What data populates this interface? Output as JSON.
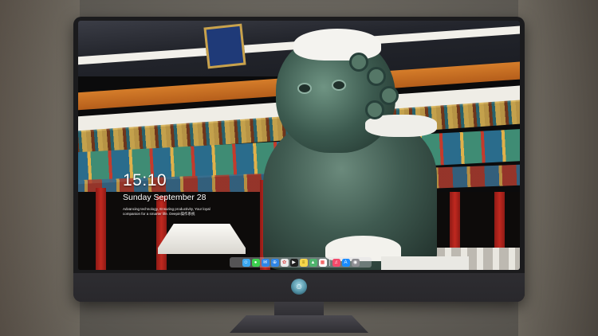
{
  "lockscreen": {
    "time": "15:10",
    "date": "Sunday September 28",
    "tagline": "Advancing technology, Ensuring productivity, Your loyal companion for a smarter life. Deepin操作系统"
  },
  "dock": {
    "items": [
      {
        "name": "finder-icon",
        "glyph": "☺",
        "color": "#3aa7f0"
      },
      {
        "name": "messages-icon",
        "glyph": "●",
        "color": "#3ccf4e"
      },
      {
        "name": "mail-icon",
        "glyph": "✉",
        "color": "#2f86e8"
      },
      {
        "name": "safari-icon",
        "glyph": "⊕",
        "color": "#2f86e8"
      },
      {
        "name": "photos-icon",
        "glyph": "✿",
        "color": "#e8e8e8"
      },
      {
        "name": "clapper-icon",
        "glyph": "▶",
        "color": "#1f1f1f"
      },
      {
        "name": "notes-icon",
        "glyph": "≡",
        "color": "#f5d64b"
      },
      {
        "name": "maps-icon",
        "glyph": "▲",
        "color": "#4fb36d"
      },
      {
        "name": "calendar-icon",
        "glyph": "▦",
        "color": "#ffffff"
      },
      {
        "name": "music-icon",
        "glyph": "♫",
        "color": "#f24a6b"
      },
      {
        "name": "app-store-icon",
        "glyph": "A",
        "color": "#1a8cff"
      },
      {
        "name": "camera-icon",
        "glyph": "◉",
        "color": "#8e8e93"
      }
    ]
  },
  "colors": {
    "frame": "#1b1b1d",
    "chin": "#2e2d31"
  }
}
